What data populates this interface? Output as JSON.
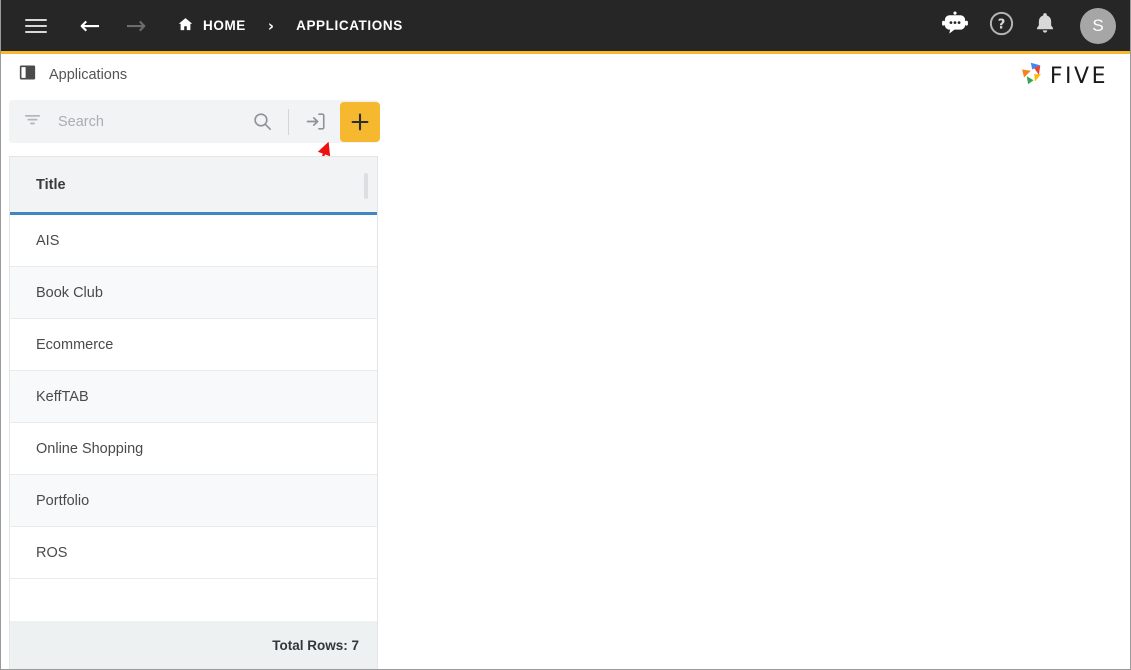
{
  "topbar": {
    "menu_icon": "hamburger-menu-icon",
    "back_icon": "arrow-left-icon",
    "back_glyph": "←",
    "forward_icon": "arrow-right-icon",
    "forward_glyph": "→",
    "breadcrumbs": [
      {
        "label": "HOME",
        "icon": "home-icon"
      },
      {
        "label": "APPLICATIONS",
        "icon": ""
      }
    ],
    "separator": "›",
    "actions": [
      {
        "name": "chat-bot-icon"
      },
      {
        "name": "help-icon"
      },
      {
        "name": "notifications-bell-icon"
      }
    ],
    "avatar_initial": "S",
    "accent_color": "#F5B82E",
    "background_color": "#262626"
  },
  "subheader": {
    "icon": "panel-book-icon",
    "title": "Applications",
    "logo": {
      "wordmark": "FIVE",
      "mark_icon": "five-pinwheel-logo-icon",
      "colors": [
        "#4285F4",
        "#EA4335",
        "#FBBC05",
        "#F5821F",
        "#34A853"
      ]
    }
  },
  "toolbar": {
    "filter_icon": "filter-icon",
    "search_value": "",
    "search_placeholder": "Search",
    "search_icon": "search-magnifier-icon",
    "import_icon": "import-arrow-into-box-icon",
    "add_icon": "plus-icon",
    "add_label": "+",
    "add_button_color": "#F5B82E"
  },
  "annotation": {
    "type": "arrow",
    "color": "#EE1111",
    "points_to": "add-button"
  },
  "grid": {
    "columns": [
      {
        "key": "title",
        "label": "Title"
      }
    ],
    "rows": [
      {
        "title": "AIS"
      },
      {
        "title": "Book Club"
      },
      {
        "title": "Ecommerce"
      },
      {
        "title": "KeffTAB"
      },
      {
        "title": "Online Shopping"
      },
      {
        "title": "Portfolio"
      },
      {
        "title": "ROS"
      }
    ],
    "footer_label": "Total Rows: 7",
    "header_underline_color": "#4285c5"
  }
}
